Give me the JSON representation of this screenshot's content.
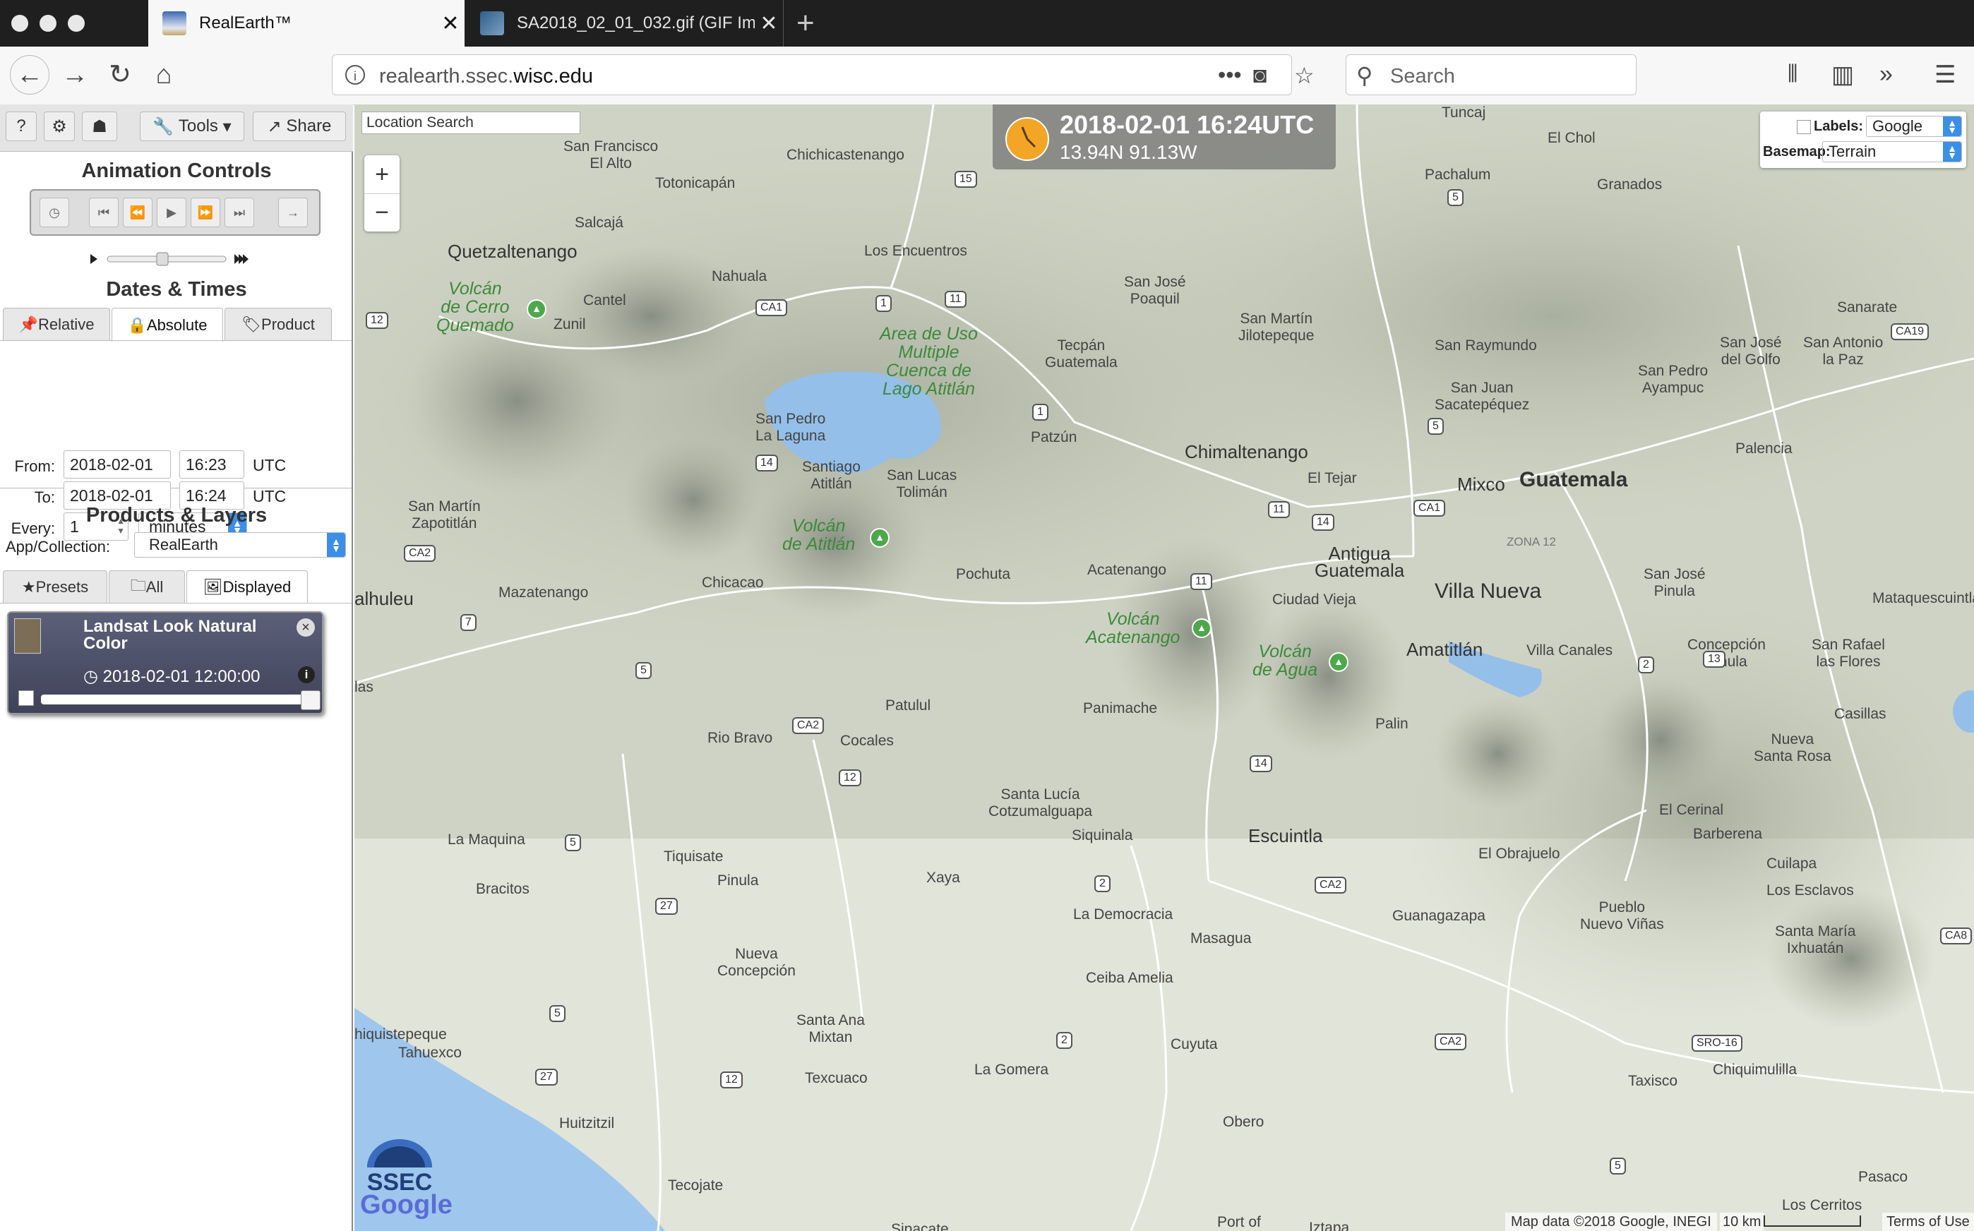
{
  "browser": {
    "tabs": [
      {
        "title": "RealEarth™",
        "active": true
      },
      {
        "title": "SA2018_02_01_032.gif (GIF Ima",
        "active": false
      }
    ],
    "url_prefix": "realearth.ssec.",
    "url_domain": "wisc.edu",
    "search_placeholder": "Search"
  },
  "panel": {
    "top_buttons": {
      "help": "?",
      "settings": "⚙",
      "user": "☗",
      "tools": "Tools",
      "share": "Share"
    },
    "animation_title": "Animation Controls",
    "dates_title": "Dates & Times",
    "date_tabs": [
      "Relative",
      "Absolute",
      "Product"
    ],
    "from_label": "From:",
    "from_date": "2018-02-01",
    "from_time": "16:23",
    "to_label": "To:",
    "to_date": "2018-02-01",
    "to_time": "16:24",
    "utc": "UTC",
    "every_label": "Every:",
    "every_value": "1",
    "every_unit": "minutes",
    "products_title": "Products & Layers",
    "app_label": "App/Collection:",
    "app_value": "RealEarth",
    "layer_tabs": [
      "Presets",
      "All",
      "Displayed"
    ],
    "layer": {
      "title": "Landsat Look Natural Color",
      "time": "2018-02-01 12:00:00",
      "opacity": 1.0
    }
  },
  "map": {
    "location_search_placeholder": "Location Search",
    "zoom_in": "+",
    "zoom_out": "−",
    "time": "2018-02-01 16:24UTC",
    "coords": "13.94N 91.13W",
    "labels_label": "Labels:",
    "labels_value": "Google",
    "basemap_label": "Basemap:",
    "basemap_value": "Terrain",
    "logo_text": "SSEC",
    "google": "Google",
    "attribution": "Map data ©2018 Google, INEGI",
    "scale": "10 km",
    "terms": "Terms of Use",
    "places": {
      "tuncaj": "Tuncaj",
      "el_chol": "El Chol",
      "san_francisco": "San Francisco\nEl Alto",
      "chichicastenango": "Chichicastenango",
      "pachalum": "Pachalum",
      "granados": "Granados",
      "totonicapan": "Totonicapán",
      "quetzaltenango": "Quetzaltenango",
      "salcaja": "Salcajá",
      "los_encuentros": "Los Encuentros",
      "nahuala": "Nahuala",
      "cantel": "Cantel",
      "zunil": "Zunil",
      "san_jose_poaquil": "San José\nPoaquil",
      "san_martin": "San Martín\nJilotepeque",
      "sanarate": "Sanarate",
      "san_jose_golfo": "San José\ndel Golfo",
      "san_antonio": "San Antonio\nla Paz",
      "tecpan": "Tecpán\nGuatemala",
      "san_raymundo": "San Raymundo",
      "san_pedro_ayampuc": "San Pedro\nAyampuc",
      "san_juan": "San Juan\nSacatepéquez",
      "san_pedro_laguna": "San Pedro\nLa Laguna",
      "patzun": "Patzún",
      "chimaltenango": "Chimaltenango",
      "palencia": "Palencia",
      "santiago_atitlan": "Santiago\nAtitlán",
      "san_lucas": "San Lucas\nTolimán",
      "el_tejar": "El Tejar",
      "mixco": "Mixco",
      "guatemala": "Guatemala",
      "san_martin_zapotitlan": "San Martín\nZapotitlán",
      "zona12": "ZONA 12",
      "antigua": "Antigua\nGuatemala",
      "retalhuleu": "alhuleu",
      "mazatenango": "Mazatenango",
      "chicacao": "Chicacao",
      "pochuta": "Pochuta",
      "acatenango": "Acatenango",
      "ciudad_vieja": "Ciudad Vieja",
      "villa_nueva": "Villa Nueva",
      "san_jose_pinula": "San José\nPinula",
      "mataquescuintla": "Mataquescuintla",
      "amatitlan": "Amatitlán",
      "villa_canales": "Villa Canales",
      "concepcion_pinula": "Concepción\nPinula",
      "san_rafael": "San Rafael\nlas Flores",
      "patulul": "Patulul",
      "panimache": "Panimache",
      "palin": "Palin",
      "casillas": "Casillas",
      "rio_bravo": "Rio Bravo",
      "cocales": "Cocales",
      "nueva_santa_rosa": "Nueva\nSanta Rosa",
      "las": "las",
      "santa_lucia": "Santa Lucía\nCotzumalguapa",
      "el_cerinal": "El Cerinal",
      "escuintla": "Escuintla",
      "siquinala": "Siquinala",
      "barberena": "Barberena",
      "la_maquina": "La Maquina",
      "tiquisate": "Tiquisate",
      "el_obrajuelo": "El Obrajuelo",
      "cuilapa": "Cuilapa",
      "pinula": "Pinula",
      "xaya": "Xaya",
      "bracitos": "Bracitos",
      "los_esclavos": "Los Esclavos",
      "la_democracia": "La Democracia",
      "guanagazapa": "Guanagazapa",
      "pueblo_nuevo": "Pueblo\nNuevo Viñas",
      "masagua": "Masagua",
      "santa_maria": "Santa María\nIxhuatán",
      "nueva_concepcion": "Nueva\nConcepción",
      "ceiba_amelia": "Ceiba Amelia",
      "santa_ana": "Santa Ana\nMixtan",
      "champerico": "hiquistepeque",
      "tahuexco": "Tahuexco",
      "cuyuta": "Cuyuta",
      "la_gomera": "La Gomera",
      "texcuaco": "Texcuaco",
      "taxisco": "Taxisco",
      "chiquimulilla": "Chiquimulilla",
      "obero": "Obero",
      "huitzitzil": "Huitzitzil",
      "tecojate": "Tecojate",
      "pasaco": "Pasaco",
      "los_cerritos": "Los Cerritos",
      "sipacate": "Sipacate",
      "port_of": "Port of",
      "iztapa": "Iztapa"
    },
    "parks": {
      "volcan_cerro_quemado": "Volcán\nde Cerro\nQuemado",
      "area_uso": "Area de Uso\nMultiple\nCuenca de\nLago Atitlán",
      "volcan_atitlan": "Volcán\nde Atitlán",
      "volcan_acatenango": "Volcán\nAcatenango",
      "volcan_agua": "Volcán\nde Agua"
    },
    "roads": {
      "r15": "15",
      "r5": "5",
      "ca1": "CA1",
      "r1": "1",
      "r11": "11",
      "r12": "12",
      "ca19": "CA19",
      "r1b": "1",
      "r14": "14",
      "r5b": "5",
      "ca1b": "CA1",
      "r11b": "11",
      "r14b": "14",
      "ca2": "CA2",
      "r7": "7",
      "r5c": "5",
      "r11c": "11",
      "r2": "2",
      "r13": "13",
      "ca2b": "CA2",
      "r12b": "12",
      "r14c": "14",
      "r5d": "5",
      "r27": "27",
      "r2b": "2",
      "ca2c": "CA2",
      "r5e": "5",
      "r2c": "2",
      "r27b": "27",
      "r12c": "12",
      "ca2d": "CA2",
      "sro16": "SRO-16",
      "ca8": "CA8",
      "r5f": "5"
    }
  }
}
